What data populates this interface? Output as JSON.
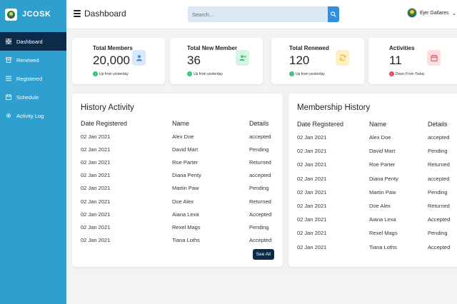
{
  "app": {
    "brand": "JCOSK"
  },
  "sidebar": {
    "items": [
      {
        "label": "Dashboard",
        "icon": "grid-icon"
      },
      {
        "label": "Renewed",
        "icon": "archive-icon"
      },
      {
        "label": "Registered",
        "icon": "list-icon"
      },
      {
        "label": "Schedule",
        "icon": "calendar-icon"
      },
      {
        "label": "Activity Log",
        "icon": "gear-icon"
      }
    ]
  },
  "header": {
    "title": "Dashboard",
    "search_placeholder": "Search...",
    "user_name": "Ejer Gallares"
  },
  "stats": [
    {
      "title": "Total Members",
      "value": "20,000",
      "sub": "Up from yesterday",
      "trend": "up",
      "icon": "user-icon",
      "icon_bg": "#d8e9fb",
      "icon_color": "#3b8be0"
    },
    {
      "title": "Total New Member",
      "value": "36",
      "sub": "Up from yesterday",
      "trend": "up",
      "icon": "user-plus-icon",
      "icon_bg": "#d6f3e4",
      "icon_color": "#3cbf7a"
    },
    {
      "title": "Total Renewed",
      "value": "120",
      "sub": "Up from yesterday",
      "trend": "up",
      "icon": "refresh-icon",
      "icon_bg": "#fdf0c8",
      "icon_color": "#f1b51f"
    },
    {
      "title": "Activities",
      "value": "11",
      "sub": "Down From Today",
      "trend": "down",
      "icon": "calendar-icon",
      "icon_bg": "#fcdfe2",
      "icon_color": "#e34a5a"
    }
  ],
  "history_activity": {
    "title": "History Activity",
    "columns": [
      "Date Registered",
      "Name",
      "Details"
    ],
    "rows": [
      [
        "02 Jan 2021",
        "Alex Doe",
        "accepted"
      ],
      [
        "02 Jan 2021",
        "David Mart",
        "Pending"
      ],
      [
        "02 Jan 2021",
        "Roe Parter",
        "Returned"
      ],
      [
        "02 Jan 2021",
        "Diana Penty",
        "accepted"
      ],
      [
        "02 Jan 2021",
        "Martin Paw",
        "Pending"
      ],
      [
        "02 Jan 2021",
        "Doe Alex",
        "Returned"
      ],
      [
        "02 Jan 2021",
        "Aiana Lexa",
        "Accepted"
      ],
      [
        "02 Jan 2021",
        "Rexel Mags",
        "Pending"
      ],
      [
        "02 Jan 2021",
        "Tiana Loths",
        "Accepted"
      ]
    ],
    "see_all": "See All"
  },
  "membership_history": {
    "title": "Membership History",
    "columns": [
      "Date Registered",
      "Name",
      "Details"
    ],
    "rows": [
      [
        "02 Jan 2021",
        "Alex Doe",
        "accepted"
      ],
      [
        "02 Jan 2021",
        "David Mart",
        "Pending"
      ],
      [
        "02 Jan 2021",
        "Roe Parter",
        "Returned"
      ],
      [
        "02 Jan 2021",
        "Diana Penty",
        "accepted"
      ],
      [
        "02 Jan 2021",
        "Martin Paw",
        "Pending"
      ],
      [
        "02 Jan 2021",
        "Doe Alex",
        "Returned"
      ],
      [
        "02 Jan 2021",
        "Aiana Lexa",
        "Accepted"
      ],
      [
        "02 Jan 2021",
        "Rexel Mags",
        "Pending"
      ],
      [
        "02 Jan 2021",
        "Tiana Loths",
        "Accepted"
      ]
    ]
  },
  "colors": {
    "sidebar": "#2f9fd0",
    "active": "#0c2a4a",
    "up": "#3cbf7a",
    "down": "#e34a5a"
  }
}
